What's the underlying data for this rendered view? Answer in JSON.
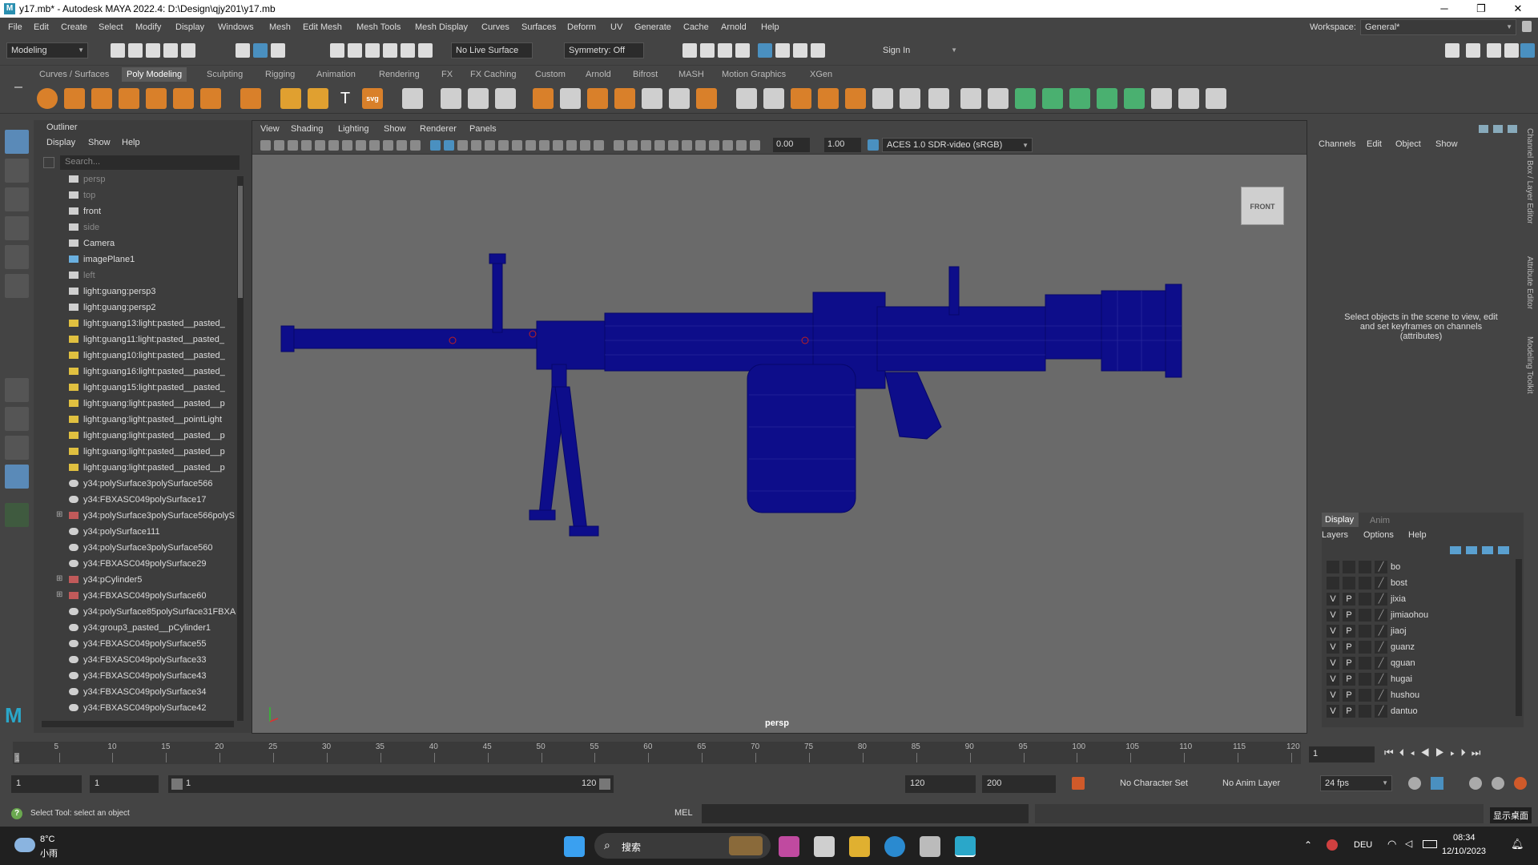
{
  "titlebar": {
    "title": "y17.mb* - Autodesk MAYA 2022.4: D:\\Design\\qjy201\\y17.mb",
    "icon": "M",
    "minimize": "─",
    "maximize": "❐",
    "close": "✕"
  },
  "menubar": {
    "items": [
      "File",
      "Edit",
      "Create",
      "Select",
      "Modify",
      "Display",
      "Windows",
      "Mesh",
      "Edit Mesh",
      "Mesh Tools",
      "Mesh Display",
      "Curves",
      "Surfaces",
      "Deform",
      "UV",
      "Generate",
      "Cache",
      "Arnold",
      "Help"
    ],
    "workspace_label": "Workspace:",
    "workspace_value": "General*"
  },
  "statusline": {
    "mode": "Modeling",
    "live_surface": "No Live Surface",
    "symmetry": "Symmetry: Off",
    "sign_in": "Sign In"
  },
  "shelf": {
    "tabs": [
      "Curves / Surfaces",
      "Poly Modeling",
      "Sculpting",
      "Rigging",
      "Animation",
      "Rendering",
      "FX",
      "FX Caching",
      "Custom",
      "Arnold",
      "Bifrost",
      "MASH",
      "Motion Graphics",
      "XGen"
    ],
    "active": "Poly Modeling",
    "svg_label": "svg"
  },
  "outliner": {
    "title": "Outliner",
    "menus": [
      "Display",
      "Show",
      "Help"
    ],
    "search_placeholder": "Search...",
    "items": [
      {
        "label": "persp",
        "dim": true,
        "icon": "camera"
      },
      {
        "label": "top",
        "dim": true,
        "icon": "camera"
      },
      {
        "label": "front",
        "dim": false,
        "icon": "camera"
      },
      {
        "label": "side",
        "dim": true,
        "icon": "camera"
      },
      {
        "label": "Camera",
        "dim": false,
        "icon": "camera"
      },
      {
        "label": "imagePlane1",
        "dim": false,
        "icon": "image-plane"
      },
      {
        "label": "left",
        "dim": true,
        "icon": "camera"
      },
      {
        "label": "light:guang:persp3",
        "dim": false,
        "icon": "camera"
      },
      {
        "label": "light:guang:persp2",
        "dim": false,
        "icon": "camera"
      },
      {
        "label": "light:guang13:light:pasted__pasted_",
        "dim": false,
        "icon": "light"
      },
      {
        "label": "light:guang11:light:pasted__pasted_",
        "dim": false,
        "icon": "light"
      },
      {
        "label": "light:guang10:light:pasted__pasted_",
        "dim": false,
        "icon": "light"
      },
      {
        "label": "light:guang16:light:pasted__pasted_",
        "dim": false,
        "icon": "light"
      },
      {
        "label": "light:guang15:light:pasted__pasted_",
        "dim": false,
        "icon": "light"
      },
      {
        "label": "light:guang:light:pasted__pasted__p",
        "dim": false,
        "icon": "light"
      },
      {
        "label": "light:guang:light:pasted__pointLight",
        "dim": false,
        "icon": "light"
      },
      {
        "label": "light:guang:light:pasted__pasted__p",
        "dim": false,
        "icon": "light"
      },
      {
        "label": "light:guang:light:pasted__pasted__p",
        "dim": false,
        "icon": "light"
      },
      {
        "label": "light:guang:light:pasted__pasted__p",
        "dim": false,
        "icon": "light"
      },
      {
        "label": "y34:polySurface3polySurface566",
        "dim": false,
        "icon": "mesh"
      },
      {
        "label": "y34:FBXASC049polySurface17",
        "dim": false,
        "icon": "mesh"
      },
      {
        "label": "y34:polySurface3polySurface566polyS",
        "dim": false,
        "icon": "group",
        "expand": "⊞"
      },
      {
        "label": "y34:polySurface111",
        "dim": false,
        "icon": "mesh"
      },
      {
        "label": "y34:polySurface3polySurface560",
        "dim": false,
        "icon": "mesh"
      },
      {
        "label": "y34:FBXASC049polySurface29",
        "dim": false,
        "icon": "mesh"
      },
      {
        "label": "y34:pCylinder5",
        "dim": false,
        "icon": "group",
        "expand": "⊞"
      },
      {
        "label": "y34:FBXASC049polySurface60",
        "dim": false,
        "icon": "group",
        "expand": "⊞"
      },
      {
        "label": "y34:polySurface85polySurface31FBXA",
        "dim": false,
        "icon": "mesh"
      },
      {
        "label": "y34:group3_pasted__pCylinder1",
        "dim": false,
        "icon": "mesh"
      },
      {
        "label": "y34:FBXASC049polySurface55",
        "dim": false,
        "icon": "mesh"
      },
      {
        "label": "y34:FBXASC049polySurface33",
        "dim": false,
        "icon": "mesh"
      },
      {
        "label": "y34:FBXASC049polySurface43",
        "dim": false,
        "icon": "mesh"
      },
      {
        "label": "y34:FBXASC049polySurface34",
        "dim": false,
        "icon": "mesh"
      },
      {
        "label": "y34:FBXASC049polySurface42",
        "dim": false,
        "icon": "mesh"
      }
    ]
  },
  "viewport": {
    "menus": [
      "View",
      "Shading",
      "Lighting",
      "Show",
      "Renderer",
      "Panels"
    ],
    "exposure": "0.00",
    "gamma": "1.00",
    "color_space": "ACES 1.0 SDR-video (sRGB)",
    "camera_label": "persp",
    "viewcube_label": "FRONT"
  },
  "channelbox": {
    "menus": [
      "Channels",
      "Edit",
      "Object",
      "Show"
    ],
    "message": "Select objects in the scene to view, edit and set keyframes on channels (attributes)",
    "side_tabs": [
      "Channel Box / Layer Editor",
      "Attribute Editor",
      "Modeling Toolkit"
    ]
  },
  "layers": {
    "tabs": [
      "Display",
      "Anim"
    ],
    "active_tab": "Display",
    "menus": [
      "Layers",
      "Options",
      "Help"
    ],
    "rows": [
      {
        "v": "",
        "p": "",
        "name": "bo"
      },
      {
        "v": "",
        "p": "",
        "name": "bost"
      },
      {
        "v": "V",
        "p": "P",
        "name": "jixia"
      },
      {
        "v": "V",
        "p": "P",
        "name": "jimiaohou"
      },
      {
        "v": "V",
        "p": "P",
        "name": "jiaoj"
      },
      {
        "v": "V",
        "p": "P",
        "name": "guanz"
      },
      {
        "v": "V",
        "p": "P",
        "name": "qguan"
      },
      {
        "v": "V",
        "p": "P",
        "name": "hugai"
      },
      {
        "v": "V",
        "p": "P",
        "name": "hushou"
      },
      {
        "v": "V",
        "p": "P",
        "name": "dantuo"
      }
    ]
  },
  "timeline": {
    "ticks": [
      "5",
      "10",
      "15",
      "20",
      "25",
      "30",
      "35",
      "40",
      "45",
      "50",
      "55",
      "60",
      "65",
      "70",
      "75",
      "80",
      "85",
      "90",
      "95",
      "100",
      "105",
      "110",
      "115",
      "120"
    ],
    "start_marker": "1",
    "current_frame": "1"
  },
  "range": {
    "start": "1",
    "anim_start": "1",
    "range_start": "1",
    "range_end": "120",
    "playback_end": "120",
    "anim_end": "200",
    "character_set": "No Character Set",
    "anim_layer": "No Anim Layer",
    "fps": "24 fps",
    "show_desktop": "显示桌面"
  },
  "cmdline": {
    "help": "Select Tool: select an object",
    "lang": "MEL"
  },
  "taskbar": {
    "temp": "8°C",
    "weather": "小雨",
    "search": "搜索",
    "lang": "DEU",
    "time": "08:34",
    "date": "12/10/2023"
  },
  "colors": {
    "wire": "#0d0d8a",
    "bg": "#444444",
    "canvas": "#6a6a6a",
    "accent": "#5a8ab8",
    "taskbar": "#202020"
  }
}
